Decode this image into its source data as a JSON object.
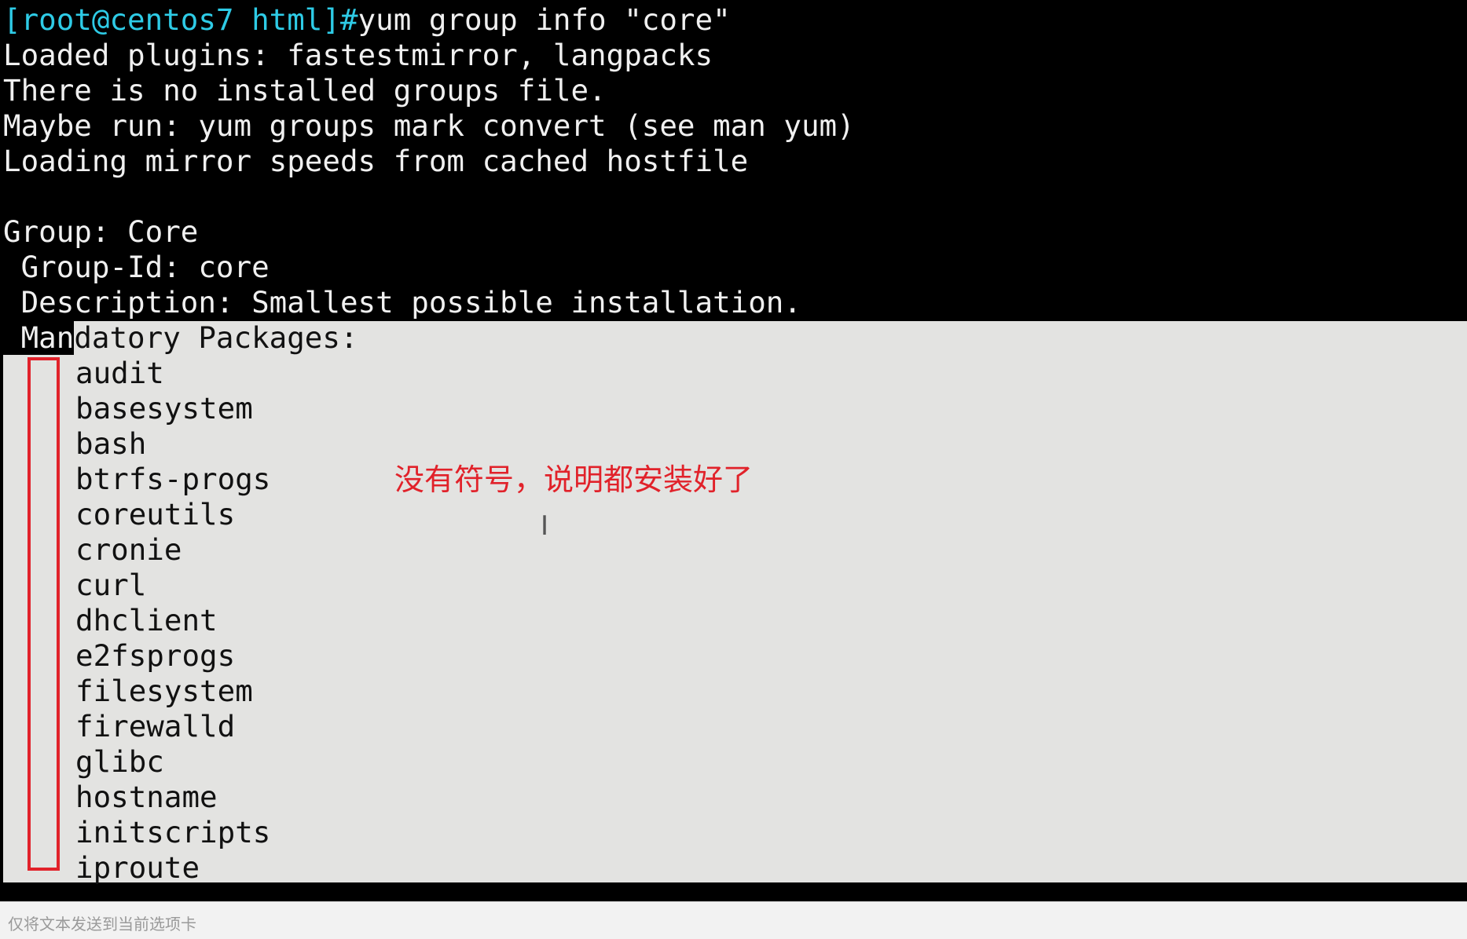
{
  "terminal": {
    "prompt": "[root@centos7 html]#",
    "command": "yum group info \"core\"",
    "output": [
      "Loaded plugins: fastestmirror, langpacks",
      "There is no installed groups file.",
      "Maybe run: yum groups mark convert (see man yum)",
      "Loading mirror speeds from cached hostfile",
      "",
      "Group: Core",
      " Group-Id: core",
      " Description: Smallest possible installation."
    ],
    "mandatory_head": " Man",
    "mandatory_tail": "datory Packages:",
    "packages": [
      "audit",
      "basesystem",
      "bash",
      "btrfs-progs",
      "coreutils",
      "cronie",
      "curl",
      "dhclient",
      "e2fsprogs",
      "filesystem",
      "firewalld",
      "glibc",
      "hostname",
      "initscripts",
      "iproute"
    ]
  },
  "annotation": {
    "text": "没有符号，说明都安装好了",
    "color": "#e1222a"
  },
  "status_bar": {
    "text": "仅将文本发送到当前选项卡"
  },
  "colors": {
    "prompt": "#2ecbe6",
    "selection": "#e3e3e1",
    "background": "#000000"
  }
}
